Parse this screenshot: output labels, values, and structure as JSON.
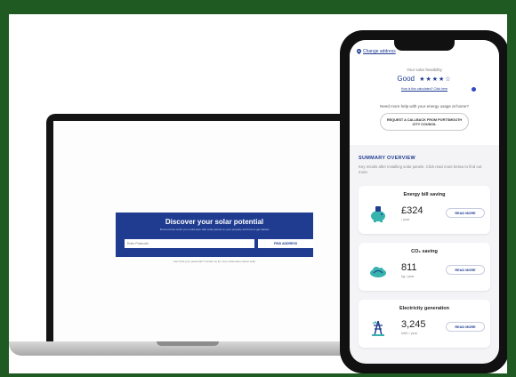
{
  "laptop": {
    "hero": {
      "title": "Discover your solar potential",
      "subtitle": "Find out how much you could save with solar panels on your property and how to get started",
      "input_placeholder": "Enter Postcode",
      "button_label": "FIND ADDRESS"
    },
    "note": "Can't find your postcode? Contact us for more information about solar"
  },
  "phone": {
    "change_link": "Change address",
    "feasibility_label": "Your solar feasibility",
    "feasibility_rating": "Good",
    "feasibility_stars": "★★★★☆",
    "calc_link": "How is this calculated? Click here",
    "help_text": "Need more help with your energy usage at home?",
    "callback_button": "REQUEST A CALLBACK FROM PORTSMOUTH CITY COUNCIL",
    "summary_title": "SUMMARY OVERVIEW",
    "summary_desc": "Key results after installing solar panels. Click read more below to find out more.",
    "cards": [
      {
        "title": "Energy bill saving",
        "value": "£324",
        "unit": "/ year",
        "button": "READ MORE"
      },
      {
        "title": "CO₂ saving",
        "value": "811",
        "unit": "kg / year",
        "button": "READ MORE"
      },
      {
        "title": "Electricity generation",
        "value": "3,245",
        "unit": "kWh / year",
        "button": "READ MORE"
      }
    ]
  },
  "colors": {
    "background": "#1f5a22",
    "brand_blue": "#1f3c91",
    "accent_teal": "#37b3ad"
  }
}
